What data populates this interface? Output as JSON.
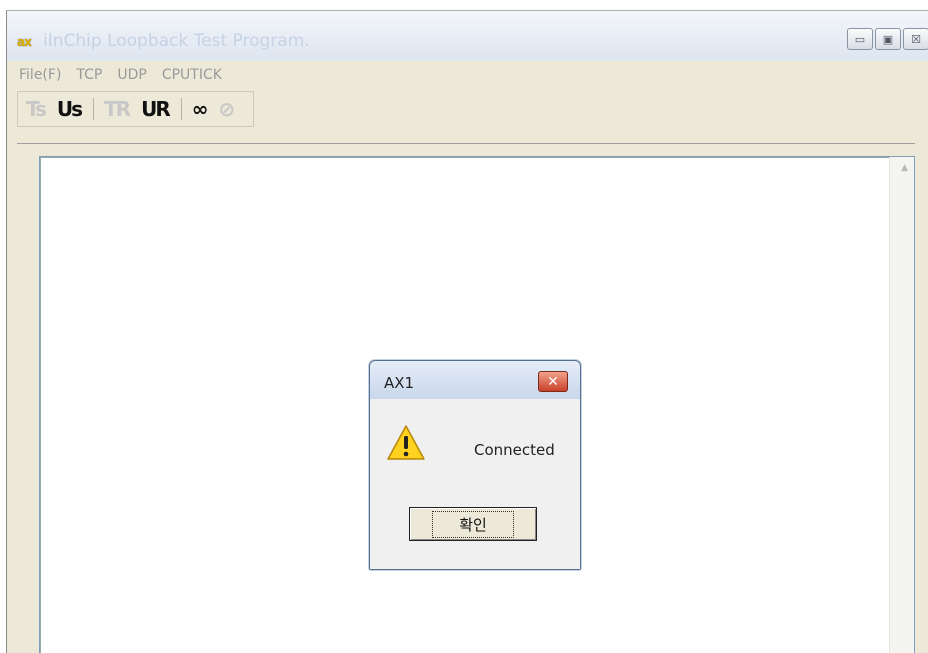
{
  "app": {
    "icon_text": "ax",
    "title": "iInChip Loopback Test Program."
  },
  "window_controls": {
    "minimize_glyph": "▭",
    "restore_glyph": "▣",
    "close_glyph": "☒"
  },
  "menu": {
    "items": [
      {
        "label": "File(F)"
      },
      {
        "label": "TCP"
      },
      {
        "label": "UDP"
      },
      {
        "label": "CPUTICK"
      }
    ]
  },
  "toolbar": {
    "buttons": [
      {
        "label": "Ts",
        "enabled": false,
        "icon": "tcp-send-icon"
      },
      {
        "label": "Us",
        "enabled": true,
        "icon": "udp-send-icon"
      },
      {
        "label": "TR",
        "enabled": false,
        "icon": "tcp-receive-icon"
      },
      {
        "label": "UR",
        "enabled": true,
        "icon": "udp-receive-icon"
      },
      {
        "label": "∞",
        "enabled": true,
        "icon": "loop-icon"
      },
      {
        "label": "⊘",
        "enabled": false,
        "icon": "stop-icon"
      }
    ]
  },
  "scroll": {
    "up_glyph": "▲"
  },
  "dialog": {
    "title": "AX1",
    "close_glyph": "✕",
    "message": "Connected",
    "ok_label": "확인",
    "icon": "warning-icon"
  }
}
